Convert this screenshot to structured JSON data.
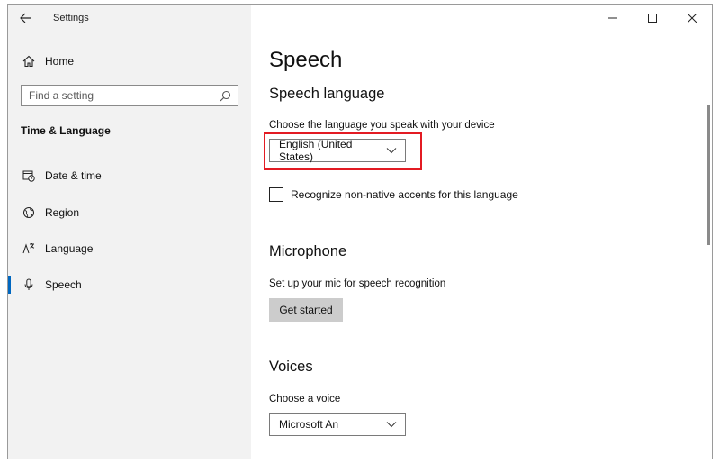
{
  "app": {
    "title": "Settings"
  },
  "sidebar": {
    "home_label": "Home",
    "search": {
      "placeholder": "Find a setting",
      "value": ""
    },
    "section_heading": "Time & Language",
    "items": [
      {
        "label": "Date & time",
        "icon": "calendar-clock-icon"
      },
      {
        "label": "Region",
        "icon": "globe-icon"
      },
      {
        "label": "Language",
        "icon": "language-icon"
      },
      {
        "label": "Speech",
        "icon": "microphone-icon",
        "active": true
      }
    ]
  },
  "main": {
    "title": "Speech",
    "speech_language": {
      "heading": "Speech language",
      "description": "Choose the language you speak with your device",
      "selected": "English (United States)",
      "checkbox_label": "Recognize non-native accents for this language",
      "checkbox_checked": false
    },
    "microphone": {
      "heading": "Microphone",
      "description": "Set up your mic for speech recognition",
      "button_label": "Get started"
    },
    "voices": {
      "heading": "Voices",
      "description": "Choose a voice",
      "selected": "Microsoft An"
    }
  },
  "colors": {
    "accent": "#0067c0",
    "highlight": "#e31b23",
    "sidebar_bg": "#f2f2f2"
  }
}
